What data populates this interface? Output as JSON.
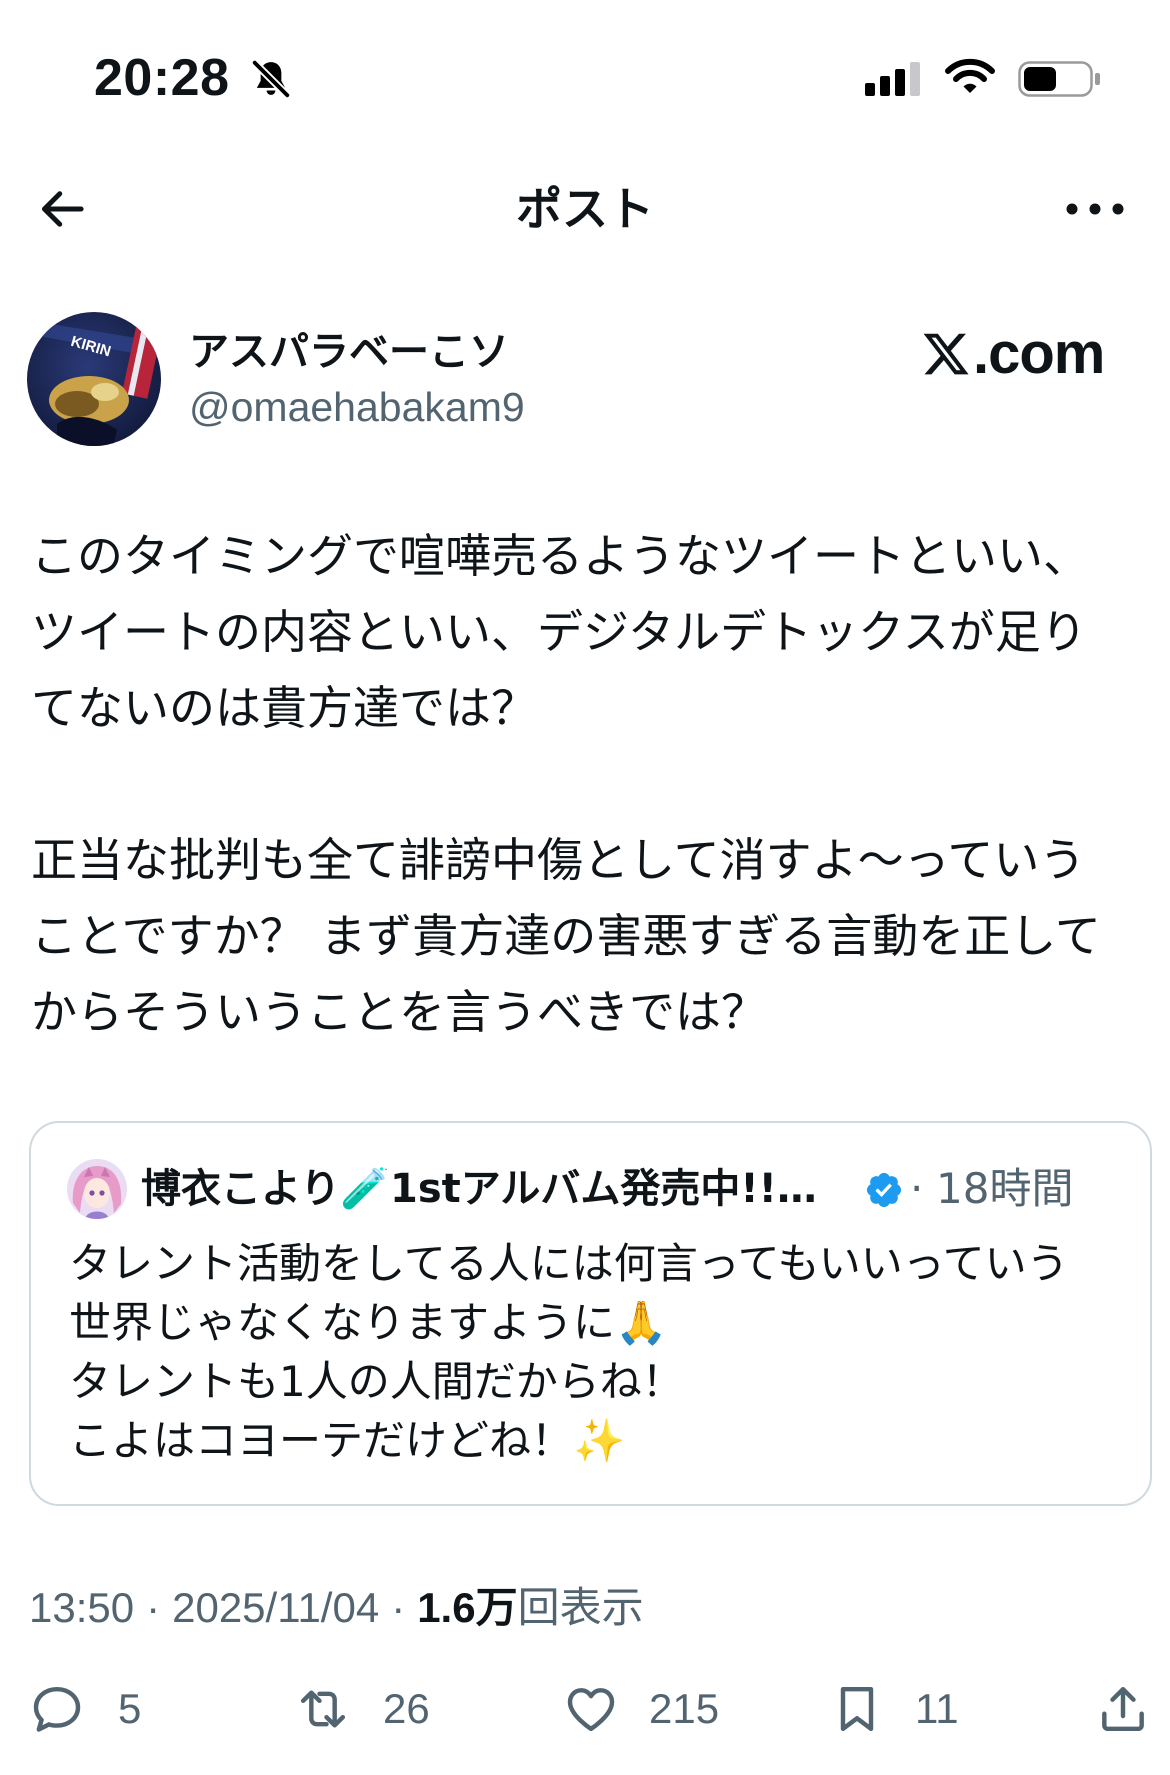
{
  "status_bar": {
    "time": "20:28",
    "icons": [
      "bell-slash-icon",
      "signal-icon",
      "wifi-icon",
      "battery-icon"
    ],
    "signal_bars": 3,
    "signal_bars_total": 4,
    "battery_level": 0.5
  },
  "nav": {
    "back_icon": "arrow-left-icon",
    "title": "ポスト",
    "more_icon": "more-horizontal-icon"
  },
  "author": {
    "display_name": "アスパラベーこソ",
    "handle": "@omaehabakam9",
    "avatar_logo_text": "KIRIN"
  },
  "watermark": {
    "mark": "X",
    "suffix": ".com"
  },
  "body": {
    "paragraphs": [
      [
        "このタイミングで喧嘩売るようなツイートといい、",
        "ツイートの内容といい、デジタルデトックスが足り",
        "てないのは貴方達では？"
      ],
      [
        "正当な批判も全て誹謗中傷として消すよ〜っていう",
        "ことですか？ まず貴方達の害悪すぎる言動を正して",
        "からそういうことを言うべきでは？"
      ]
    ]
  },
  "quote": {
    "author_name": "博衣こより🧪1stアルバム発売中!!…",
    "verified_icon": "verified-badge-icon",
    "separator": "·",
    "time_ago": "18時間",
    "lines": [
      "タレント活動をしてる人には何言ってもいいっていう",
      "世界じゃなくなりますように🙏",
      "タレントも1人の人間だからね！",
      "こよはコヨーテだけどね！✨"
    ]
  },
  "meta": {
    "time": "13:50",
    "separator": "·",
    "date": "2025/11/04",
    "views_count": "1.6万",
    "views_label": "回表示"
  },
  "actions": {
    "reply": {
      "icon": "reply-icon",
      "count": "5"
    },
    "repost": {
      "icon": "repost-icon",
      "count": "26"
    },
    "like": {
      "icon": "heart-icon",
      "count": "215"
    },
    "bookmark": {
      "icon": "bookmark-icon",
      "count": "11"
    },
    "share": {
      "icon": "share-icon"
    }
  },
  "colors": {
    "text": "#0f1419",
    "secondary": "#536471",
    "border": "#cfd9de",
    "verified": "#1d9bf0"
  }
}
